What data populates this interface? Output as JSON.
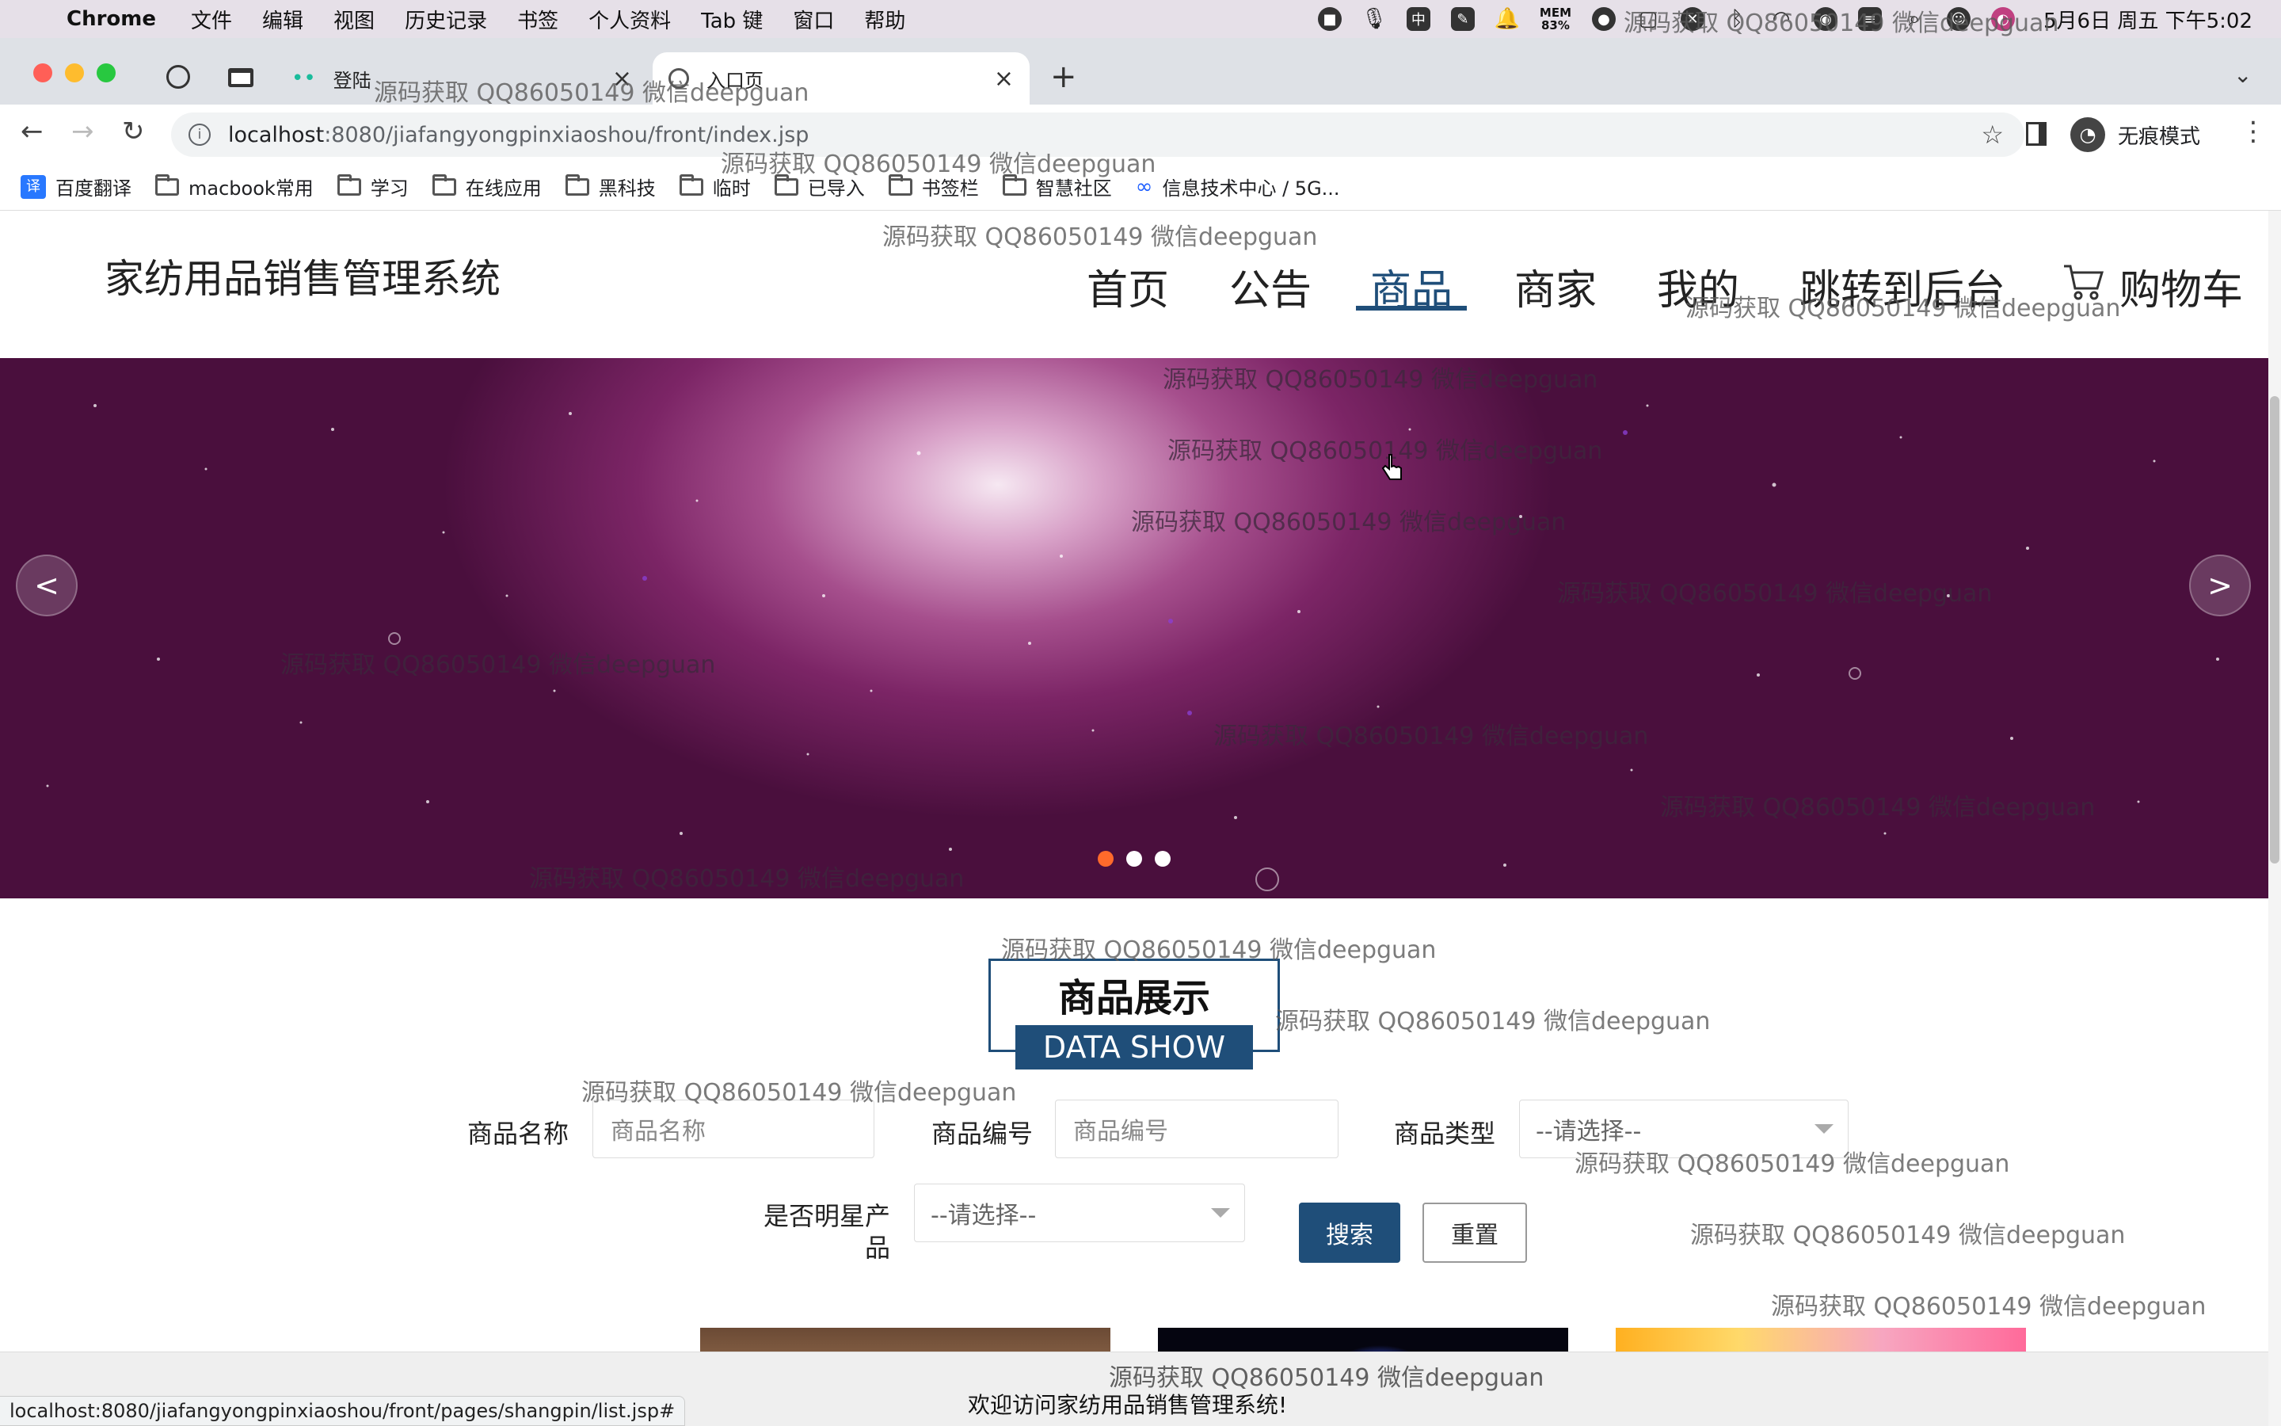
{
  "menubar": {
    "app": "Chrome",
    "items": [
      "文件",
      "编辑",
      "视图",
      "历史记录",
      "书签",
      "个人资料",
      "Tab 键",
      "窗口",
      "帮助"
    ],
    "mem": "MEM\n83%",
    "clock": "5月6日 周五 下午5:02"
  },
  "tabs": [
    {
      "title": "登陆",
      "close": "×"
    },
    {
      "title": "入口页",
      "close": "×"
    }
  ],
  "toolbar": {
    "url_host": "localhost",
    "url_path": ":8080/jiafangyongpinxiaoshou/front/index.jsp",
    "profile_label": "无痕模式"
  },
  "bookmarks": [
    "百度翻译",
    "macbook常用",
    "学习",
    "在线应用",
    "黑科技",
    "临时",
    "已导入",
    "书签栏",
    "智慧社区",
    "信息技术中心 / 5G..."
  ],
  "site": {
    "title": "家纺用品销售管理系统",
    "nav": [
      "首页",
      "公告",
      "商品",
      "商家",
      "我的",
      "跳转到后台",
      "购物车"
    ],
    "current_nav": "商品"
  },
  "banner": {
    "prev": "<",
    "next": ">",
    "slides": 3,
    "active_slide": 1
  },
  "section": {
    "title": "商品展示",
    "subtitle": "DATA SHOW"
  },
  "filters": {
    "name_label": "商品名称",
    "name_placeholder": "商品名称",
    "code_label": "商品编号",
    "code_placeholder": "商品编号",
    "type_label": "商品类型",
    "type_value": "--请选择--",
    "star_label_line1": "是否明星产",
    "star_label_line2": "品",
    "star_value": "--请选择--",
    "search_button": "搜索",
    "reset_button": "重置"
  },
  "footer": {
    "welcome": "欢迎访问家纺用品销售管理系统!"
  },
  "status_url": "localhost:8080/jiafangyongpinxiaoshou/front/pages/shangpin/list.jsp#",
  "watermark": "源码获取 QQ86050149 微信deepguan",
  "colors": {
    "accent": "#1f4e79",
    "active_dot": "#ff6a2b"
  }
}
